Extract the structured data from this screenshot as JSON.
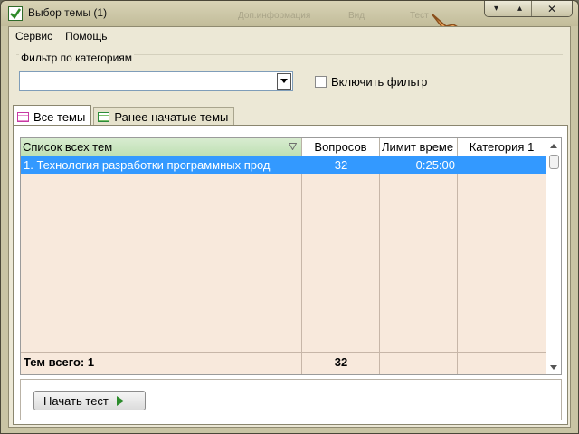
{
  "window": {
    "title": "Выбор темы (1)",
    "buttons": {
      "minimize": "▾",
      "maximize": "▴",
      "close": "✕"
    },
    "ghost_text": [
      "Доп.информация",
      "Вид",
      "Тест"
    ]
  },
  "menubar": {
    "items": [
      "Сервис",
      "Помощь"
    ]
  },
  "filter": {
    "legend": "Фильтр по категориям",
    "combo_value": "",
    "checkbox_label": "Включить фильтр",
    "checked": false
  },
  "tabs": [
    {
      "label": "Все темы",
      "active": true,
      "icon": "table-icon"
    },
    {
      "label": "Ранее начатые темы",
      "active": false,
      "icon": "table-icon"
    }
  ],
  "grid": {
    "columns": [
      "Список всех тем",
      "Вопросов",
      "Лимит време",
      "Категория 1"
    ],
    "rows": [
      {
        "name": "1. Технология разработки программных прод",
        "questions": "32",
        "limit": "0:25:00",
        "category": ""
      }
    ],
    "footer": {
      "label": "Тем всего: 1",
      "questions_total": "32"
    }
  },
  "actions": {
    "start_label": "Начать тест"
  },
  "colors": {
    "selection": "#3399ff",
    "grid_bg": "#f8e9dc",
    "sorted_header": "#c6e3bb",
    "play": "#2b8b2b"
  }
}
